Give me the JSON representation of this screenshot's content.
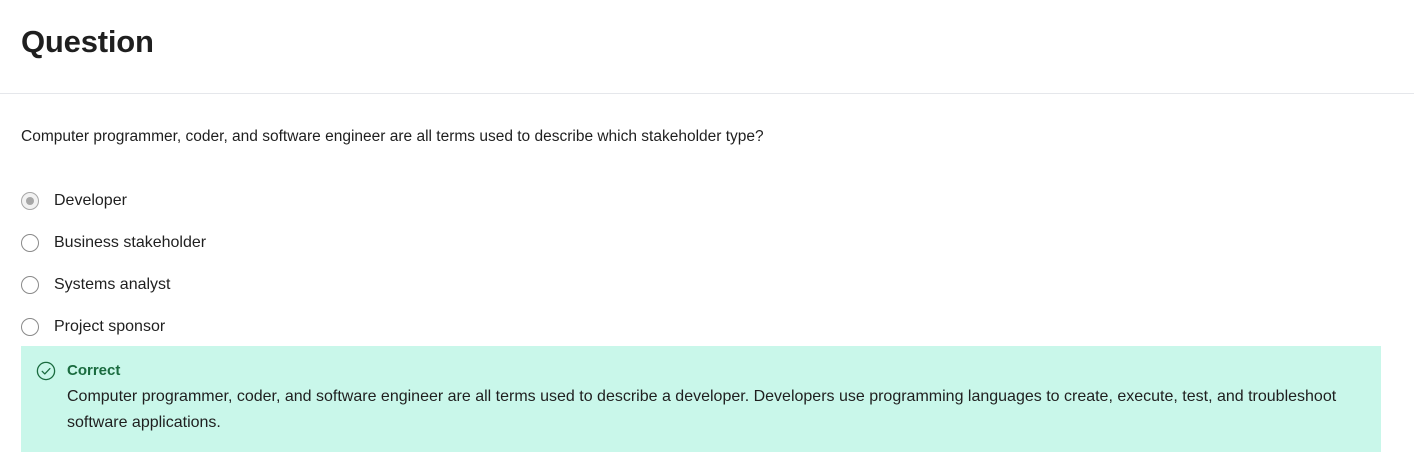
{
  "header": {
    "title": "Question"
  },
  "question": {
    "prompt": "Computer programmer, coder, and software engineer are all terms used to describe which stakeholder type?",
    "options": [
      {
        "label": "Developer",
        "selected": true
      },
      {
        "label": "Business stakeholder",
        "selected": false
      },
      {
        "label": "Systems analyst",
        "selected": false
      },
      {
        "label": "Project sponsor",
        "selected": false
      }
    ]
  },
  "feedback": {
    "status": "Correct",
    "icon": "check-circle-icon",
    "text": "Computer programmer, coder, and software engineer are all terms used to describe a developer. Developers use programming languages to create, execute, test, and troubleshoot software applications.",
    "colors": {
      "background": "#c9f7ea",
      "accent": "#1a6b3f"
    }
  }
}
